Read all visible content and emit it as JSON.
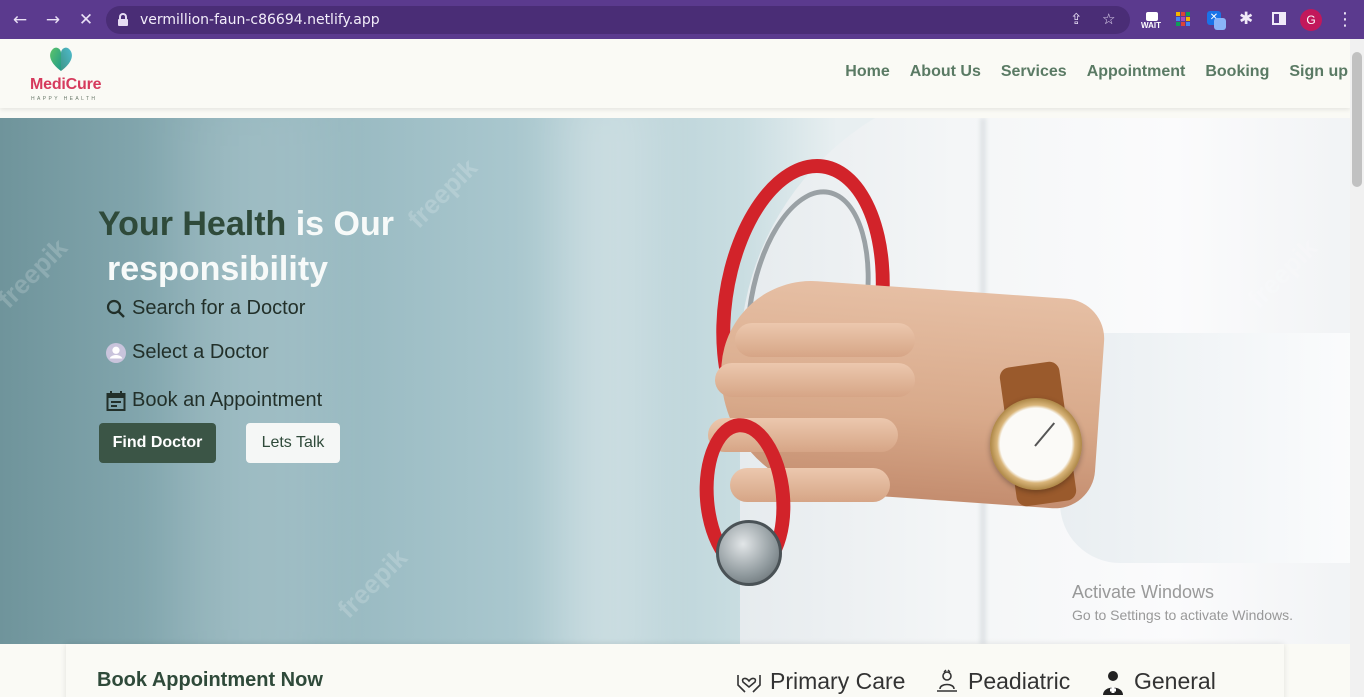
{
  "browser": {
    "url": "vermillion-faun-c86694.netlify.app",
    "back_icon": "arrow-left-icon",
    "forward_icon": "arrow-right-icon",
    "loading_icon": "close-icon",
    "extensions": {
      "wait_label": "WAIT"
    },
    "profile_initial": "G"
  },
  "navbar": {
    "logo": {
      "title": "MediCure",
      "tagline": "HAPPY HEALTH"
    },
    "links": [
      "Home",
      "About Us",
      "Services",
      "Appointment",
      "Booking",
      "Sign up"
    ]
  },
  "hero": {
    "headline_part1": "Your Health",
    "headline_part2": "is Our",
    "headline_part3": "responsibility",
    "features": [
      {
        "icon": "search-icon",
        "label": "Search for a Doctor"
      },
      {
        "icon": "user-icon",
        "label": "Select a Doctor"
      },
      {
        "icon": "calendar-icon",
        "label": "Book an Appointment"
      }
    ],
    "primary_button": "Find Doctor",
    "secondary_button": "Lets Talk"
  },
  "booking": {
    "title": "Book Appointment Now",
    "services": [
      {
        "icon": "heart-hands-icon",
        "label": "Primary Care"
      },
      {
        "icon": "child-care-icon",
        "label": "Peadiatric"
      },
      {
        "icon": "doctor-icon",
        "label": "General"
      }
    ]
  },
  "os_overlay": {
    "line1": "Activate Windows",
    "line2": "Go to Settings to activate Windows."
  },
  "colors": {
    "browser_frame": "#5b3a8e",
    "brand_dark_green": "#3b5546",
    "nav_green": "#5a7a64",
    "logo_red": "#d63a5d"
  }
}
